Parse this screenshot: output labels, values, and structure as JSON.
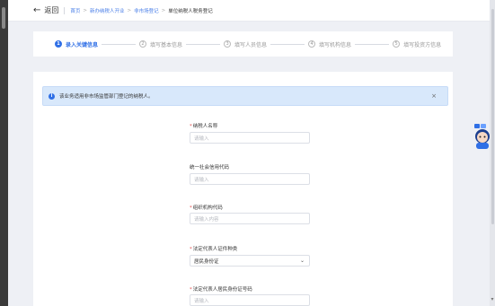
{
  "header": {
    "back_label": "返回",
    "breadcrumbs": [
      "首页",
      "新办纳税人开业",
      "非市场登记",
      "单位纳税人税务登记"
    ]
  },
  "steps": [
    {
      "number": "1",
      "label": "录入关键信息",
      "active": true
    },
    {
      "number": "2",
      "label": "填写基本信息",
      "active": false
    },
    {
      "number": "3",
      "label": "填写人员信息",
      "active": false
    },
    {
      "number": "4",
      "label": "填写机构信息",
      "active": false
    },
    {
      "number": "5",
      "label": "填写投资方信息",
      "active": false
    }
  ],
  "alert": {
    "text": "该业务适用非市场监管部门登记的纳税人。",
    "close": "×"
  },
  "form": {
    "fields": [
      {
        "label": "纳税人名称",
        "required": true,
        "placeholder": "请输入",
        "type": "input"
      },
      {
        "label": "统一社会信用代码",
        "required": false,
        "placeholder": "请输入",
        "type": "input"
      },
      {
        "label": "组织机构代码",
        "required": true,
        "placeholder": "请输入内容",
        "type": "input"
      },
      {
        "label": "法定代表人证件种类",
        "required": true,
        "value": "居民身份证",
        "type": "select"
      },
      {
        "label": "法定代表人居民身份证号码",
        "required": true,
        "placeholder": "请输入",
        "type": "input"
      }
    ]
  },
  "icons": {
    "back": "arrow-left-icon",
    "info": "info-icon",
    "close": "close-icon",
    "chevron": "chevron-down-icon",
    "assistant": "assistant-avatar-icon"
  },
  "colors": {
    "accent": "#2f6fe6",
    "alert_bg": "#d8e8fb",
    "required": "#e34d4d"
  }
}
